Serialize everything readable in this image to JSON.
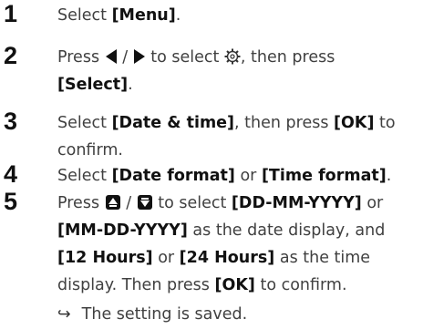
{
  "steps": [
    {
      "number": "1",
      "lines": [
        {
          "t1": "Select ",
          "b1": "[Menu]",
          "t2": "."
        }
      ]
    },
    {
      "number": "2",
      "lines": [
        {
          "t1": "Press ",
          "icon_sep": " / ",
          "t2": " to select ",
          "t3": ", then press"
        },
        {
          "b1": "[Select]",
          "t1": "."
        }
      ],
      "icons": [
        "left-triangle-icon",
        "right-triangle-icon",
        "gear-icon"
      ]
    },
    {
      "number": "3",
      "lines": [
        {
          "t1": "Select ",
          "b1": "[Date & time]",
          "t2": ", then press ",
          "b2": "[OK]",
          "t3": " to"
        },
        {
          "t1": "confirm."
        }
      ]
    },
    {
      "number": "4",
      "lines": [
        {
          "t1": "Select ",
          "b1": "[Date format]",
          "t2": " or ",
          "b2": "[Time format]",
          "t3": "."
        }
      ]
    },
    {
      "number": "5",
      "lines": [
        {
          "t1": "Press ",
          "icon_sep": " / ",
          "t2": " to select ",
          "b1": "[DD-MM-YYYY]",
          "t3": " or"
        },
        {
          "b1": "[MM-DD-YYYY]",
          "t1": " as the date display, and"
        },
        {
          "b1": "[12 Hours]",
          "t1": " or ",
          "b2": "[24 Hours]",
          "t2": " as the time"
        },
        {
          "t1": "display. Then press ",
          "b1": "[OK]",
          "t2": " to confirm."
        }
      ],
      "icons": [
        "up-button-icon",
        "down-button-icon"
      ]
    }
  ],
  "result": {
    "arrow": "↪",
    "text": "The setting is saved."
  },
  "colors": {
    "number": "#111111",
    "text": "#404040",
    "bold": "#111111"
  }
}
